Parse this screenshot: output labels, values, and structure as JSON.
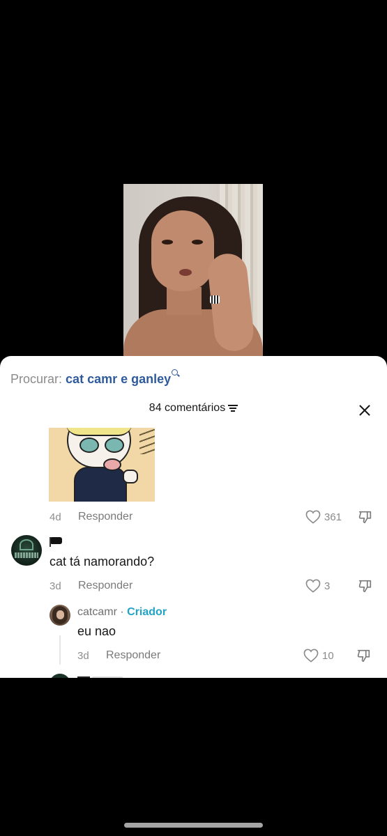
{
  "search": {
    "label": "Procurar:",
    "term": "cat camr e ganley",
    "icon": "search-icon"
  },
  "comments_header": {
    "count_label": "84 comentários",
    "filter_icon": "filter-icon",
    "close_icon": "close-icon"
  },
  "comments": [
    {
      "has_sticker": true,
      "time": "4d",
      "reply_label": "Responder",
      "likes": "361"
    },
    {
      "avatar": "avatar-anarchist-power",
      "username_emoji": "black-flag",
      "text": "cat tá namorando?",
      "time": "3d",
      "reply_label": "Responder",
      "likes": "3"
    }
  ],
  "reply": {
    "username": "catcamr",
    "separator": "·",
    "badge": "Criador",
    "text": "eu nao",
    "time": "3d",
    "reply_label": "Responder",
    "likes": "10"
  },
  "colors": {
    "search_term": "#2f5b9c",
    "creator_badge": "#21a3c4",
    "background": "#000000",
    "sheet": "#ffffff"
  }
}
